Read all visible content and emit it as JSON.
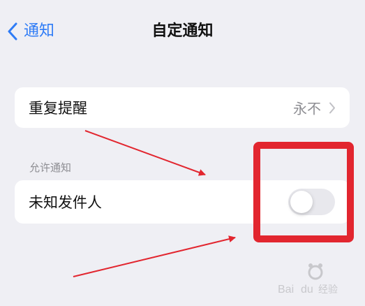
{
  "nav": {
    "back_label": "通知",
    "title": "自定通知"
  },
  "repeat_reminder": {
    "label": "重复提醒",
    "value": "永不"
  },
  "allow_notifications": {
    "section_header": "允许通知",
    "unknown_senders_label": "未知发件人",
    "toggle_on": false
  },
  "colors": {
    "background": "#efeff4",
    "card": "#ffffff",
    "accent": "#2f7cf6",
    "secondary_text": "#8e8e93",
    "annotation_red": "#e2262f"
  },
  "icons": {
    "back": "chevron-left-icon",
    "disclosure": "chevron-right-icon"
  },
  "watermark": {
    "text": "Baidu 经验"
  }
}
